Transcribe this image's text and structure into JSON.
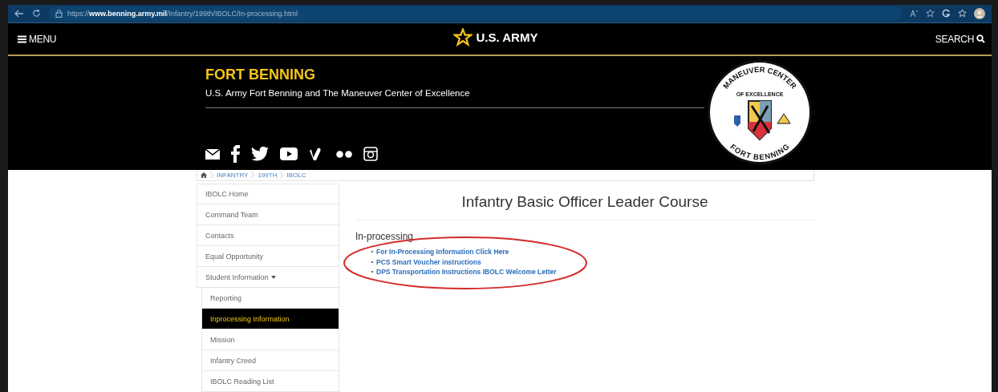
{
  "browser": {
    "url": "https://**www.benning.army.mil**/Infantry/199th/IBOLC/In-processing.html"
  },
  "nav": {
    "menu": "MENU",
    "brand": "U.S. ARMY",
    "search": "SEARCH"
  },
  "header": {
    "title": "FORT BENNING",
    "subtitle": "U.S. Army Fort Benning and The Maneuver Center of Excellence",
    "seal": {
      "top": "MANEUVER CENTER",
      "middle": "OF EXCELLENCE",
      "bottom": "FORT BENNING"
    }
  },
  "breadcrumb": [
    "INFANTRY",
    "199TH",
    "IBOLC"
  ],
  "sidebar": {
    "items": [
      {
        "label": "IBOLC Home",
        "selected": false
      },
      {
        "label": "Command Team",
        "selected": false
      },
      {
        "label": "Contacts",
        "selected": false
      },
      {
        "label": "Equal Opportunity",
        "selected": false
      },
      {
        "label": "Student Information",
        "selected": false,
        "expanded": true,
        "children": [
          {
            "label": "Reporting",
            "selected": false
          },
          {
            "label": "Inprocessing Information",
            "selected": true
          },
          {
            "label": "Mission",
            "selected": false
          },
          {
            "label": "Infantry Creed",
            "selected": false
          },
          {
            "label": "IBOLC Reading List",
            "selected": false
          }
        ]
      }
    ]
  },
  "main": {
    "title": "Infantry Basic Officer Leader Course",
    "section": "In-processing",
    "links": [
      "For In-Processing Information Click Here",
      "PCS Smart Voucher instructions",
      "DPS Transportation Instructions IBOLC Welcome Letter"
    ]
  }
}
